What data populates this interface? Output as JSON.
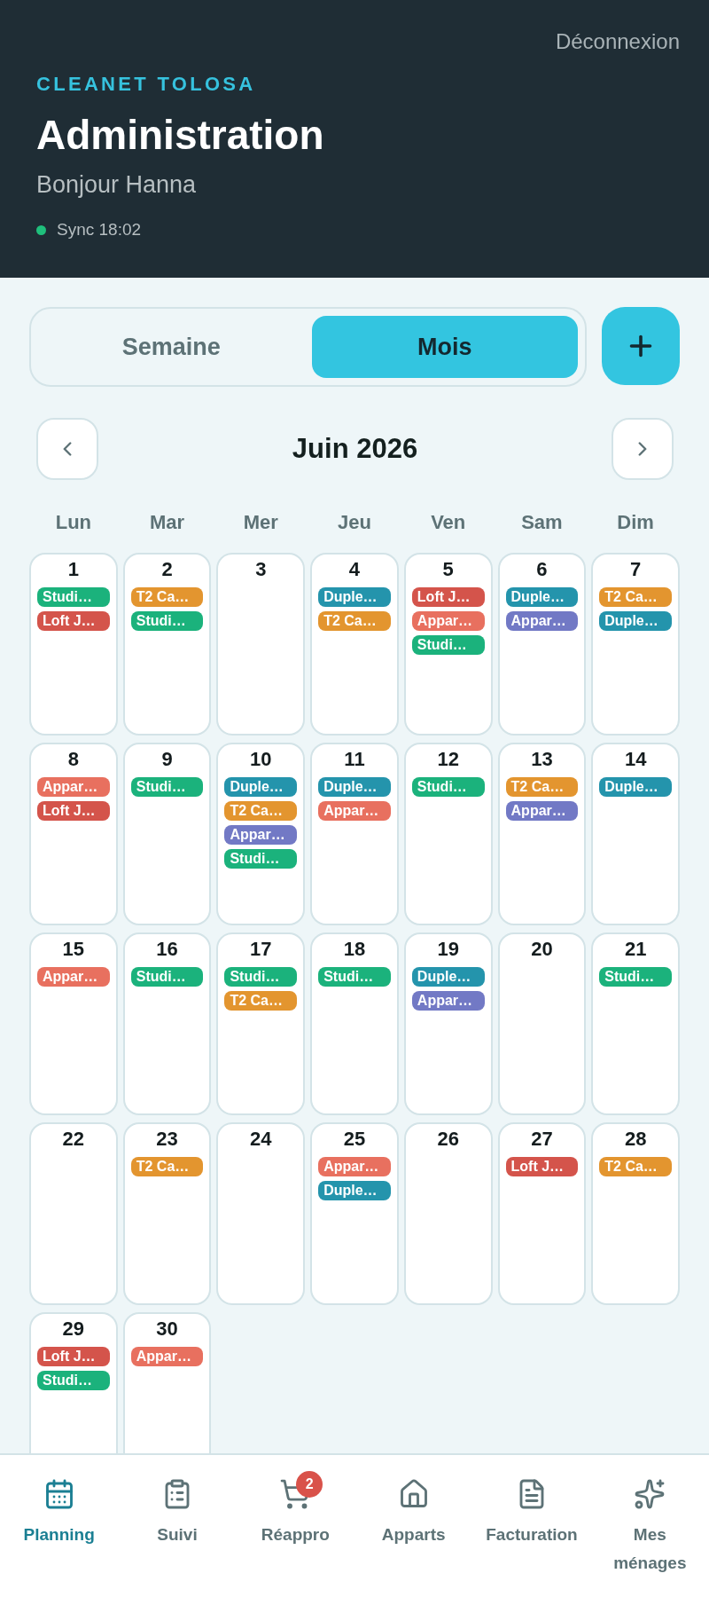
{
  "header": {
    "logout": "Déconnexion",
    "brand": "CLEANET TOLOSA",
    "title": "Administration",
    "greeting": "Bonjour Hanna",
    "sync": {
      "text": "Sync 18:02",
      "online": true
    }
  },
  "view_toggle": [
    {
      "label": "Semaine",
      "selected": false
    },
    {
      "label": "Mois",
      "selected": true
    }
  ],
  "month_nav": {
    "title": "Juin 2026"
  },
  "weekdays": [
    "Lun",
    "Mar",
    "Mer",
    "Jeu",
    "Ven",
    "Sam",
    "Dim"
  ],
  "days": [
    {
      "day": "1",
      "events": [
        {
          "label": "Studi…",
          "color": "#1bb27c"
        },
        {
          "label": "Loft J…",
          "color": "#d4544b"
        }
      ]
    },
    {
      "day": "2",
      "events": [
        {
          "label": "T2 Ca…",
          "color": "#e3952f"
        },
        {
          "label": "Studi…",
          "color": "#1bb27c"
        }
      ]
    },
    {
      "day": "3"
    },
    {
      "day": "4",
      "events": [
        {
          "label": "Duple…",
          "color": "#2494ac"
        },
        {
          "label": "T2 Ca…",
          "color": "#e3952f"
        }
      ]
    },
    {
      "day": "5",
      "events": [
        {
          "label": "Loft J…",
          "color": "#d4544b"
        },
        {
          "label": "Appar…",
          "color": "#e8705f"
        },
        {
          "label": "Studi…",
          "color": "#1bb27c"
        }
      ]
    },
    {
      "day": "6",
      "events": [
        {
          "label": "Duple…",
          "color": "#2494ac"
        },
        {
          "label": "Appar…",
          "color": "#7279c5"
        }
      ]
    },
    {
      "day": "7",
      "events": [
        {
          "label": "T2 Ca…",
          "color": "#e3952f"
        },
        {
          "label": "Duple…",
          "color": "#2494ac"
        }
      ]
    },
    {
      "day": "8",
      "events": [
        {
          "label": "Appar…",
          "color": "#e8705f"
        },
        {
          "label": "Loft J…",
          "color": "#d4544b"
        }
      ]
    },
    {
      "day": "9",
      "events": [
        {
          "label": "Studi…",
          "color": "#1bb27c"
        }
      ]
    },
    {
      "day": "10",
      "events": [
        {
          "label": "Duple…",
          "color": "#2494ac"
        },
        {
          "label": "T2 Ca…",
          "color": "#e3952f"
        },
        {
          "label": "Appar…",
          "color": "#7279c5"
        },
        {
          "label": "Studi…",
          "color": "#1bb27c"
        }
      ]
    },
    {
      "day": "11",
      "events": [
        {
          "label": "Duple…",
          "color": "#2494ac"
        },
        {
          "label": "Appar…",
          "color": "#e8705f"
        }
      ]
    },
    {
      "day": "12",
      "events": [
        {
          "label": "Studi…",
          "color": "#1bb27c"
        }
      ]
    },
    {
      "day": "13",
      "events": [
        {
          "label": "T2 Ca…",
          "color": "#e3952f"
        },
        {
          "label": "Appar…",
          "color": "#7279c5"
        }
      ]
    },
    {
      "day": "14",
      "events": [
        {
          "label": "Duple…",
          "color": "#2494ac"
        }
      ]
    },
    {
      "day": "15",
      "events": [
        {
          "label": "Appar…",
          "color": "#e8705f"
        }
      ]
    },
    {
      "day": "16",
      "events": [
        {
          "label": "Studi…",
          "color": "#1bb27c"
        }
      ]
    },
    {
      "day": "17",
      "events": [
        {
          "label": "Studi…",
          "color": "#1bb27c"
        },
        {
          "label": "T2 Ca…",
          "color": "#e3952f"
        }
      ]
    },
    {
      "day": "18",
      "events": [
        {
          "label": "Studi…",
          "color": "#1bb27c"
        }
      ]
    },
    {
      "day": "19",
      "events": [
        {
          "label": "Duple…",
          "color": "#2494ac"
        },
        {
          "label": "Appar…",
          "color": "#7279c5"
        }
      ]
    },
    {
      "day": "20"
    },
    {
      "day": "21",
      "events": [
        {
          "label": "Studi…",
          "color": "#1bb27c"
        }
      ]
    },
    {
      "day": "22"
    },
    {
      "day": "23",
      "events": [
        {
          "label": "T2 Ca…",
          "color": "#e3952f"
        }
      ]
    },
    {
      "day": "24"
    },
    {
      "day": "25",
      "events": [
        {
          "label": "Appar…",
          "color": "#e8705f"
        },
        {
          "label": "Duple…",
          "color": "#2494ac"
        }
      ]
    },
    {
      "day": "26"
    },
    {
      "day": "27",
      "events": [
        {
          "label": "Loft J…",
          "color": "#d4544b"
        }
      ]
    },
    {
      "day": "28",
      "events": [
        {
          "label": "T2 Ca…",
          "color": "#e3952f"
        }
      ]
    },
    {
      "day": "29",
      "events": [
        {
          "label": "Loft J…",
          "color": "#d4544b"
        },
        {
          "label": "Studi…",
          "color": "#1bb27c"
        }
      ]
    },
    {
      "day": "30",
      "events": [
        {
          "label": "Appar…",
          "color": "#e8705f"
        }
      ]
    }
  ],
  "nav": [
    {
      "kind": "calendar",
      "label": "Planning",
      "selected": true
    },
    {
      "kind": "clipboard",
      "label": "Suivi",
      "selected": false
    },
    {
      "kind": "cart",
      "label": "Réappro",
      "selected": false,
      "badge": "2"
    },
    {
      "kind": "house",
      "label": "Apparts",
      "selected": false
    },
    {
      "kind": "document",
      "label": "Facturation",
      "selected": false
    },
    {
      "kind": "sparkles",
      "label": "Mes ménages",
      "selected": false
    }
  ]
}
